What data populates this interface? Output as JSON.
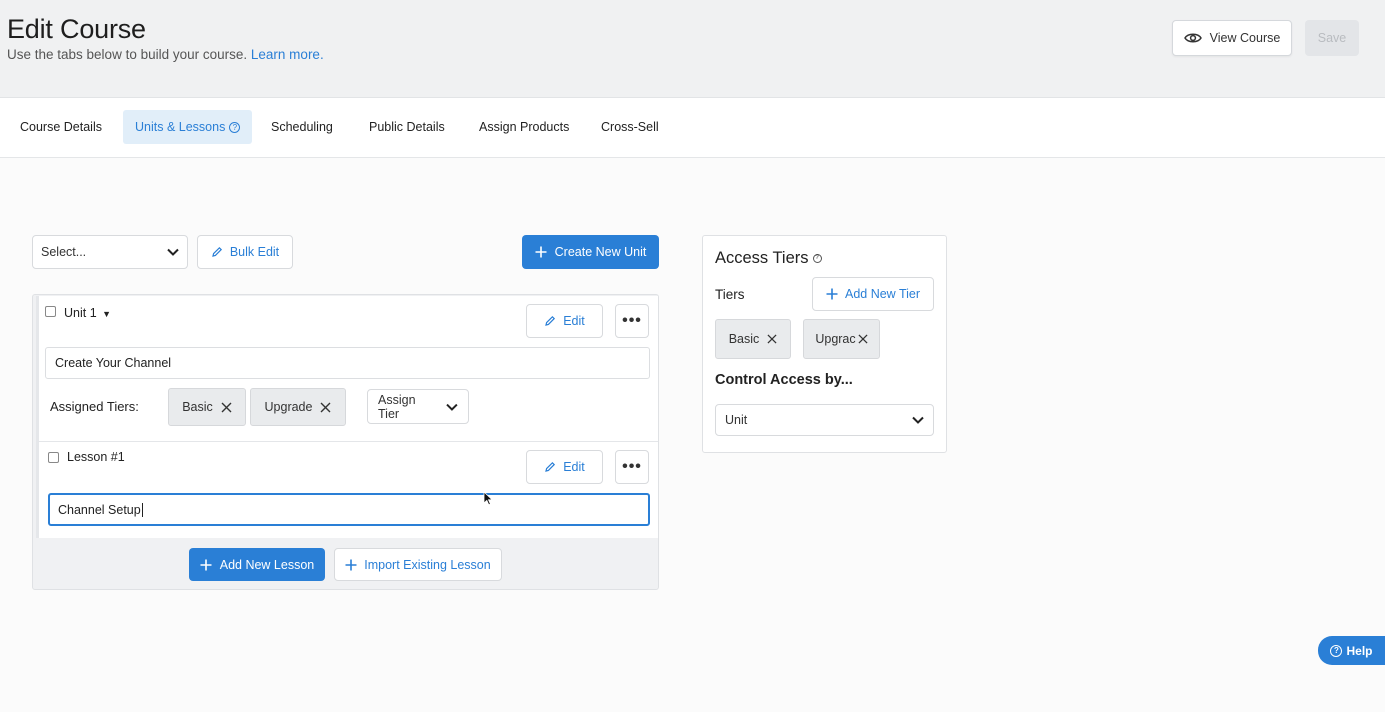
{
  "header": {
    "title": "Edit Course",
    "subtitle": "Use the tabs below to build your course.",
    "learn_more": "Learn more.",
    "view_course_label": "View Course",
    "save_label": "Save"
  },
  "tabs": [
    {
      "label": "Course Details"
    },
    {
      "label": "Units & Lessons",
      "help_icon": "question-circle-icon"
    },
    {
      "label": "Scheduling"
    },
    {
      "label": "Public Details"
    },
    {
      "label": "Assign Products"
    },
    {
      "label": "Cross-Sell"
    }
  ],
  "toolbar": {
    "select_placeholder": "Select...",
    "bulk_edit_label": "Bulk Edit",
    "create_unit_label": "Create New Unit"
  },
  "unit": {
    "label": "Unit 1",
    "edit_label": "Edit",
    "title_value": "Create Your Channel",
    "assigned_tiers_label": "Assigned Tiers:",
    "tiers": [
      "Basic",
      "Upgrade"
    ],
    "assign_tier_label": "Assign Tier"
  },
  "lesson": {
    "label": "Lesson #1",
    "edit_label": "Edit",
    "title_value": "Channel Setup"
  },
  "unit_actions": {
    "add_lesson_label": "Add New Lesson",
    "import_lesson_label": "Import Existing Lesson"
  },
  "access_tiers": {
    "title": "Access Tiers",
    "tiers_label": "Tiers",
    "add_tier_label": "Add New Tier",
    "tiers": [
      "Basic",
      "Upgrac"
    ],
    "control_title": "Control Access by...",
    "control_value": "Unit"
  },
  "help_label": "Help",
  "colors": {
    "accent": "#2a7fd6",
    "header_bg": "#f0f1f2",
    "active_tab_bg": "#e1eef9",
    "chip_bg": "#e9ebed"
  }
}
